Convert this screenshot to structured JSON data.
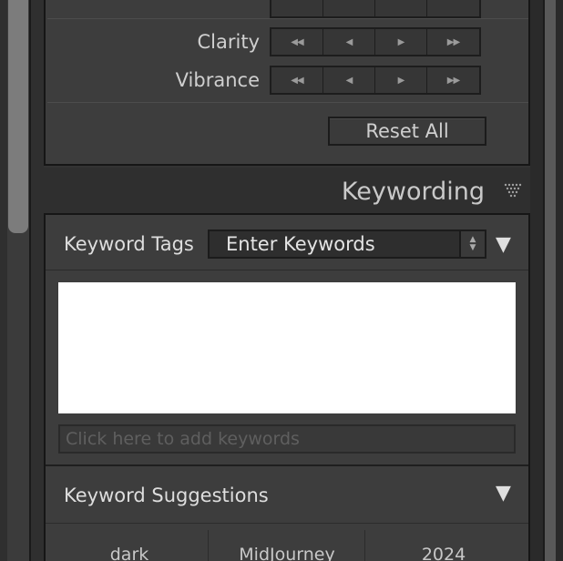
{
  "quick_develop": {
    "rows": [
      {
        "label": "Clarity",
        "buttons": [
          "◀◀",
          "◀",
          "▶",
          "▶▶"
        ]
      },
      {
        "label": "Vibrance",
        "buttons": [
          "◀◀",
          "◀",
          "▶",
          "▶▶"
        ]
      }
    ],
    "top_row_buttons": [
      "",
      "",
      "",
      ""
    ],
    "reset_all_label": "Reset All"
  },
  "keywording": {
    "title": "Keywording",
    "keyword_tags": {
      "label": "Keyword Tags",
      "mode_value": "Enter Keywords",
      "add_placeholder": "Click here to add keywords",
      "keywords_text": ""
    },
    "keyword_suggestions": {
      "label": "Keyword Suggestions",
      "items": [
        "dark",
        "MidJourney",
        "2024"
      ]
    }
  },
  "icons": {
    "panel_collapse": "triangle-down-icon",
    "header_triangle": "dotted-triangle-icon",
    "select_arrows": "up-down-arrows-icon"
  },
  "colors": {
    "panel_bg": "#3d3d3d",
    "header_bg": "#2f2f2f",
    "text": "#d4d4d4",
    "keyword_field_bg": "#ffffff"
  }
}
